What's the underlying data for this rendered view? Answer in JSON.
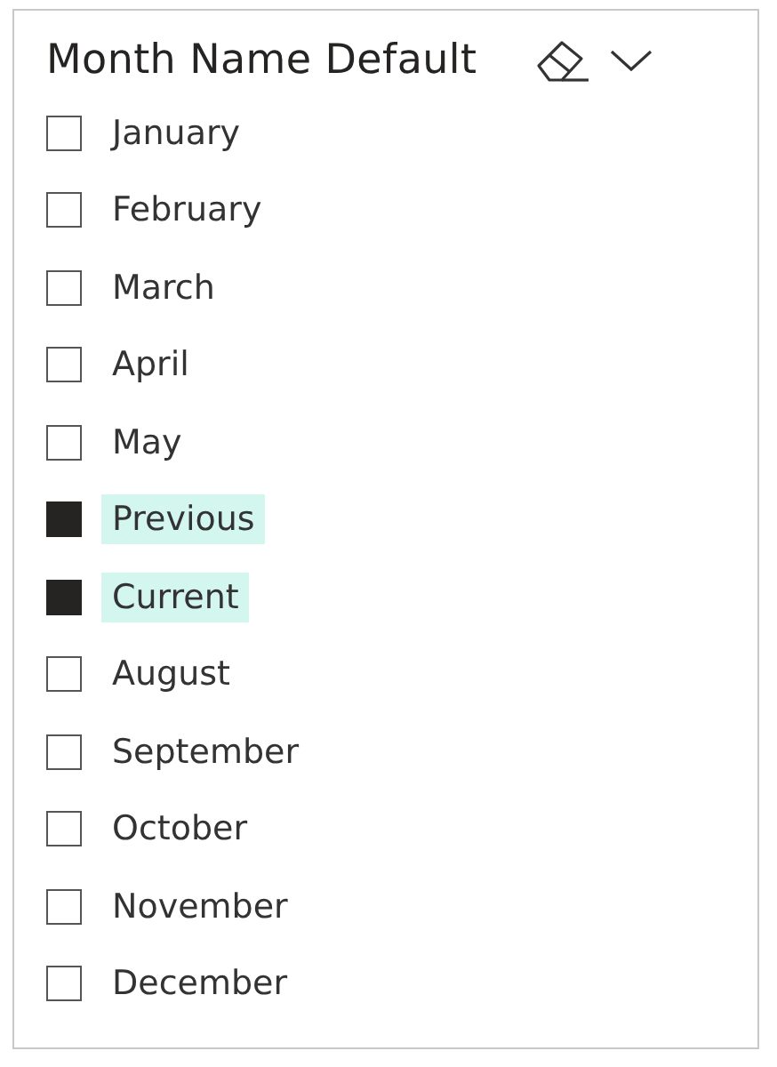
{
  "slicer": {
    "title": "Month Name Default",
    "items": [
      {
        "label": "January",
        "selected": false
      },
      {
        "label": "February",
        "selected": false
      },
      {
        "label": "March",
        "selected": false
      },
      {
        "label": "April",
        "selected": false
      },
      {
        "label": "May",
        "selected": false
      },
      {
        "label": "Previous",
        "selected": true
      },
      {
        "label": "Current",
        "selected": true
      },
      {
        "label": "August",
        "selected": false
      },
      {
        "label": "September",
        "selected": false
      },
      {
        "label": "October",
        "selected": false
      },
      {
        "label": "November",
        "selected": false
      },
      {
        "label": "December",
        "selected": false
      }
    ]
  }
}
